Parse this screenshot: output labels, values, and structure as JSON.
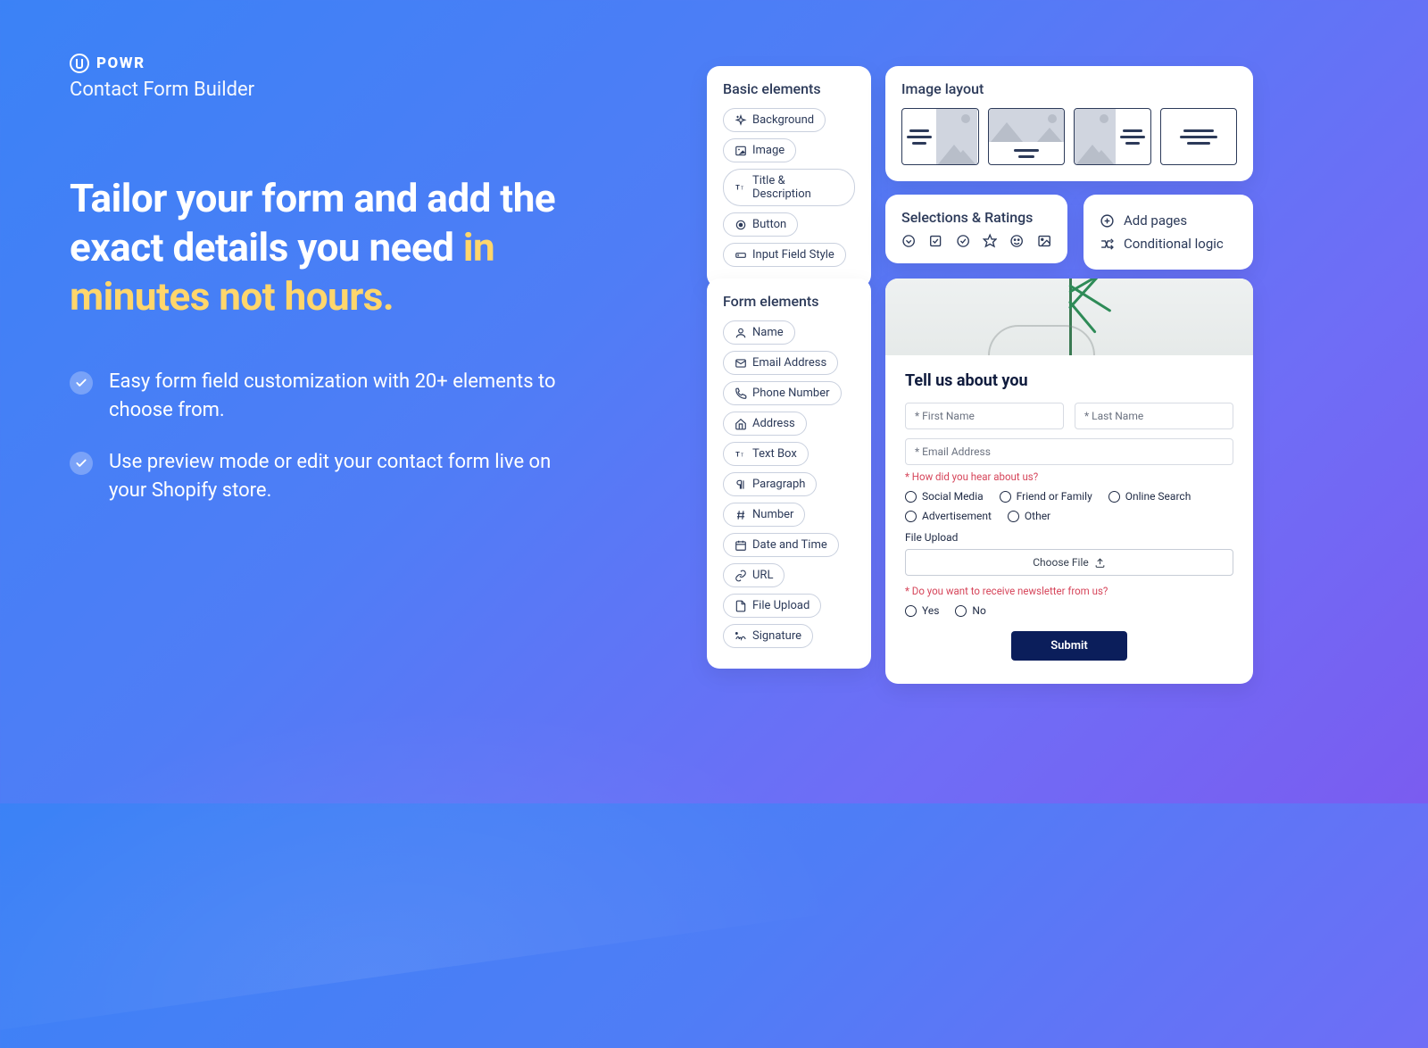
{
  "brand": {
    "name": "POWR",
    "product": "Contact Form Builder"
  },
  "headline": {
    "part1": "Tailor your form and add the exact details you need ",
    "accent": "in minutes not hours.",
    "bullets": [
      "Easy form field customization with 20+ elements to choose from.",
      "Use preview mode or edit your contact form live on your Shopify store."
    ]
  },
  "basic": {
    "title": "Basic elements",
    "items": [
      "Background",
      "Image",
      "Title & Description",
      "Button",
      "Input Field Style"
    ]
  },
  "formEl": {
    "title": "Form elements",
    "items": [
      "Name",
      "Email Address",
      "Phone Number",
      "Address",
      "Text Box",
      "Paragraph",
      "Number",
      "Date and Time",
      "URL",
      "File Upload",
      "Signature"
    ]
  },
  "imageLayout": {
    "title": "Image layout"
  },
  "selections": {
    "title": "Selections & Ratings"
  },
  "pages": {
    "add": "Add pages",
    "logic": "Conditional logic"
  },
  "preview": {
    "title": "Tell us about you",
    "firstName": "* First Name",
    "lastName": "* Last Name",
    "email": "* Email Address",
    "hearLabel": "* How did you hear about us?",
    "hearOptions": [
      "Social Media",
      "Friend or Family",
      "Online Search",
      "Advertisement",
      "Other"
    ],
    "fileLabel": "File Upload",
    "chooseFile": "Choose File",
    "newsletterLabel": "* Do you want to receive newsletter from us?",
    "newsletterOptions": [
      "Yes",
      "No"
    ],
    "submit": "Submit"
  }
}
